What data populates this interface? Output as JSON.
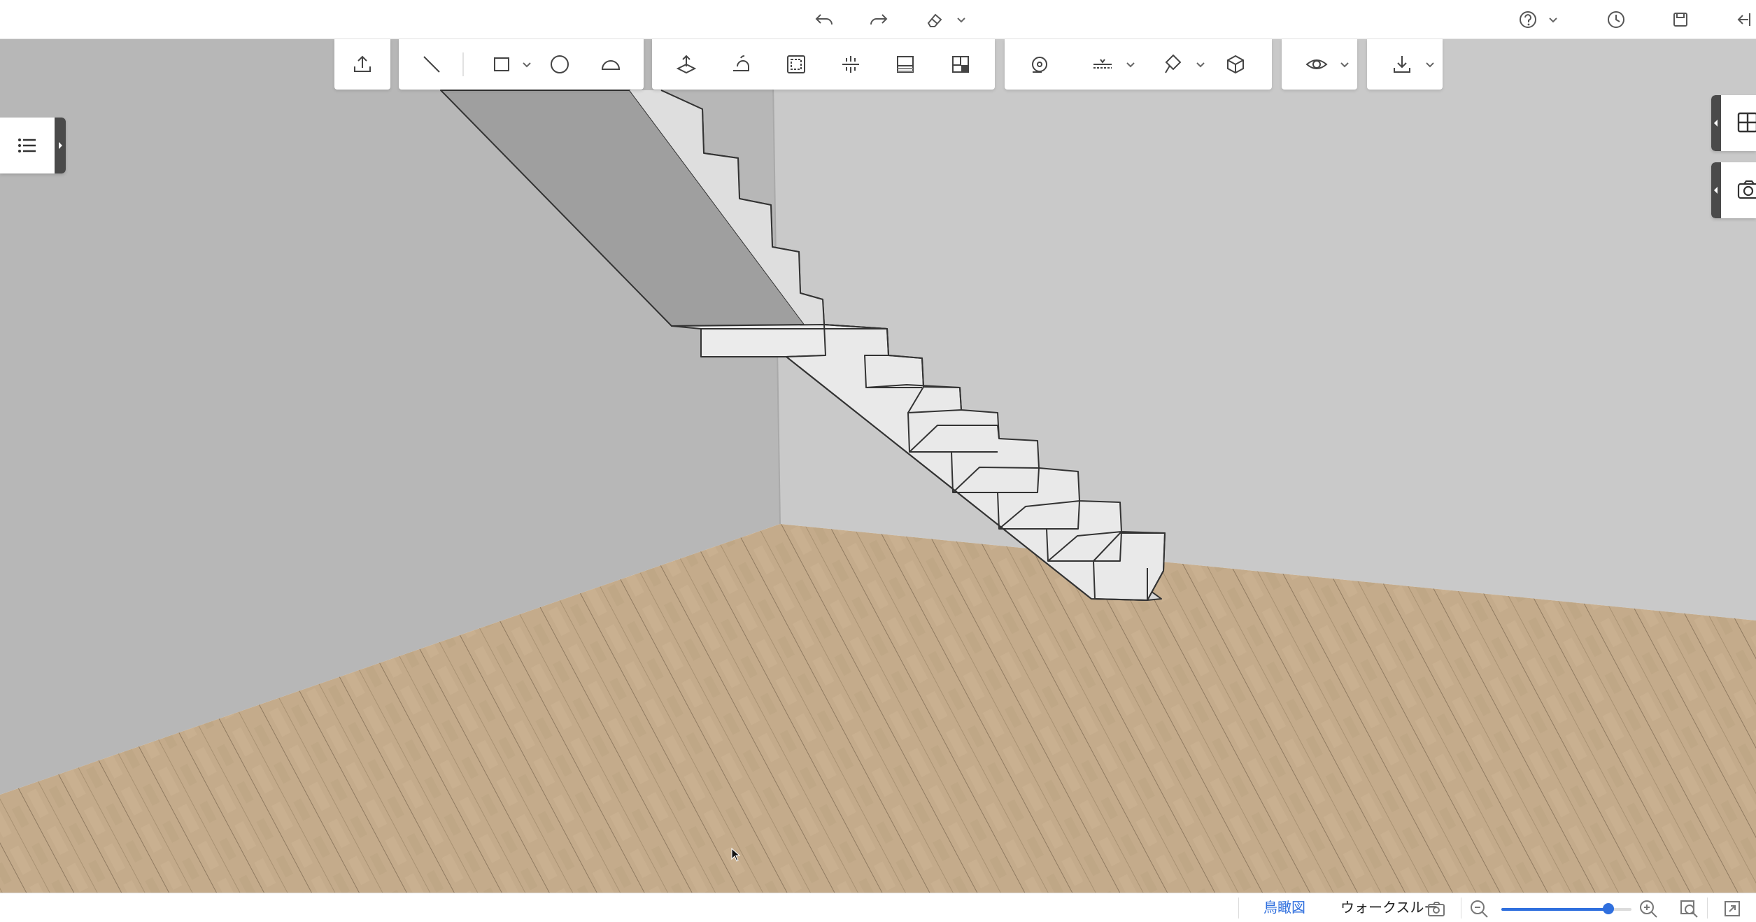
{
  "topbar": {
    "icons": [
      "undo-icon",
      "redo-icon",
      "eraser-icon",
      "help-icon",
      "history-icon",
      "save-icon",
      "exit-icon"
    ]
  },
  "toolbar": {
    "groups": [
      [
        "upload-icon"
      ],
      [
        "line-icon",
        "rectangle-icon",
        "circle-icon",
        "arc-icon"
      ],
      [
        "push-pull-icon",
        "follow-me-icon",
        "offset-icon",
        "align-icon",
        "section-icon",
        "tile-icon"
      ],
      [
        "tape-measure-icon",
        "dimension-icon",
        "paint-icon",
        "component-icon"
      ],
      [
        "view-icon"
      ],
      [
        "download-icon"
      ]
    ]
  },
  "left_panel": {
    "icon": "list-icon"
  },
  "right_panel": {
    "icons": [
      "layout-icon",
      "camera-icon"
    ]
  },
  "bottom_bar": {
    "views": [
      {
        "label": "鳥瞰図",
        "active": true
      },
      {
        "label": "ウォークスルー",
        "active": false
      }
    ],
    "zoom_level": 0.82
  },
  "colors": {
    "accent": "#2f6fde",
    "wall_left": "#b9b9b9",
    "wall_back": "#c8c8c8",
    "floor": "#c2aa8a",
    "stair": "#e8e8e8"
  }
}
